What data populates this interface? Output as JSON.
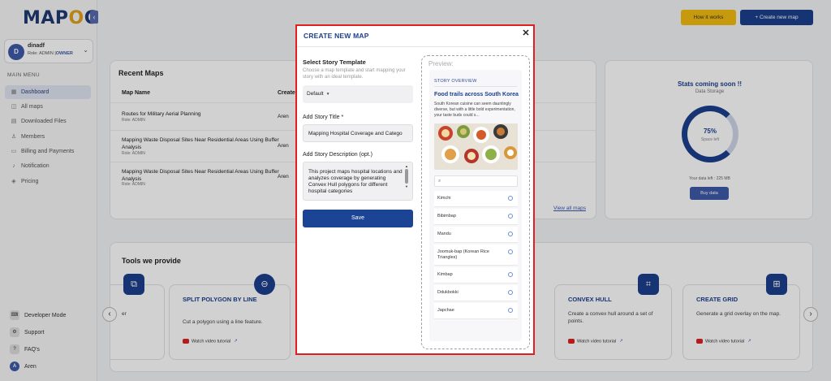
{
  "app": {
    "logo": "MAPOG"
  },
  "user": {
    "initial": "D",
    "name": "dinadf",
    "role_prefix": "Role: ADMIN |",
    "role_suffix": "OWNER"
  },
  "sidebar": {
    "menu_label": "MAIN MENU",
    "items": [
      {
        "label": "Dashboard",
        "icon": "grid-icon",
        "active": true
      },
      {
        "label": "All maps",
        "icon": "map-icon"
      },
      {
        "label": "Downloaded Files",
        "icon": "file-icon"
      },
      {
        "label": "Members",
        "icon": "users-icon"
      },
      {
        "label": "Billing and Payments",
        "icon": "card-icon"
      },
      {
        "label": "Notification",
        "icon": "bell-icon"
      },
      {
        "label": "Pricing",
        "icon": "tag-icon"
      }
    ],
    "bottom": [
      {
        "label": "Developer Mode",
        "icon": "dev-icon"
      },
      {
        "label": "Support",
        "icon": "support-icon"
      },
      {
        "label": "FAQ's",
        "icon": "faq-icon"
      },
      {
        "label": "Aren",
        "icon": "avatar-icon",
        "initial": "A"
      }
    ]
  },
  "header": {
    "how_it_works": "How it works",
    "create_new_map": "+ Create new map"
  },
  "recent_maps": {
    "title": "Recent Maps",
    "col_name": "Map Name",
    "col_creator": "Create",
    "rows": [
      {
        "name": "Routes for Military Aerial Planning",
        "role": "Role: ADMIN",
        "creator": "Aren"
      },
      {
        "name": "Mapping Waste Disposal Sites Near Residential Areas Using Buffer Analysis",
        "role": "Role: ADMIN",
        "creator": "Aren"
      },
      {
        "name": "Mapping Waste Disposal Sites Near Residential Areas Using Buffer Analysis",
        "role": "Role: ADMIN",
        "creator": "Aren"
      }
    ],
    "view_all": "View all maps"
  },
  "stats": {
    "title": "Stats coming soon !!",
    "subtitle": "Data Storage",
    "percent": "75%",
    "percent_sub": "Space left",
    "footer": "Your data left : 225 MB",
    "buy_label": "Buy data"
  },
  "tools": {
    "title": "Tools we provide",
    "cards": [
      {
        "name": "SPLIT POLYGON BY LINE",
        "desc": "Cut a polygon using a line feature.",
        "video": "Watch video tutorial"
      },
      {
        "name": "CONVEX HULL",
        "desc": "Create a convex hull around a set of points.",
        "video": "Watch video tutorial"
      },
      {
        "name": "CREATE GRID",
        "desc": "Generate a grid overlay on the map.",
        "video": "Watch video tutorial"
      }
    ],
    "partial_text": "er"
  },
  "modal": {
    "title": "CREATE NEW MAP",
    "close": "✕",
    "template_label": "Select Story Template",
    "template_hint": "Choose a map template and start mapping your story with an ideal template.",
    "template_value": "Default",
    "title_label": "Add Story Title *",
    "title_value": "Mapping Hospital Coverage and Catego",
    "desc_label": "Add Story Description (opt.)",
    "desc_value": "This project maps hospital locations and analyzes coverage by generating Convex Hull polygons for different hospital categories",
    "save": "Save"
  },
  "preview": {
    "label": "Preview:",
    "overview": "STORY OVERVIEW",
    "story_title": "Food trails across South Korea",
    "story_desc": "South Korean cuisine can seem dauntingly diverse, but with a little bold experimentation, your taste buds could s...",
    "items": [
      "Kimchi",
      "Bibimbap",
      "Mandu",
      "Joomuk-bap (Korean Rice Triangles)",
      "Kimbap",
      "Ddukbokki",
      "Japchae"
    ]
  },
  "colors": {
    "brand": "#1c3f8e",
    "accent": "#f2bc0f",
    "highlight_border": "#e02020"
  }
}
